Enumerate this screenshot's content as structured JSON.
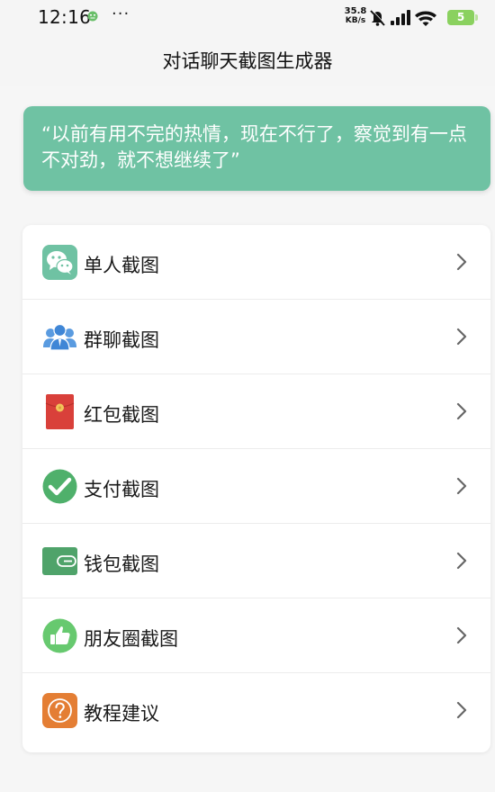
{
  "status_bar": {
    "time": "12:16",
    "dots": "···",
    "speed_value": "35.8",
    "speed_unit": "KB/s",
    "battery": "5",
    "icons": [
      "face-icon",
      "mute-bell-icon",
      "signal-icon",
      "wifi-icon",
      "battery-icon"
    ]
  },
  "header": {
    "title": "对话聊天截图生成器"
  },
  "quote": {
    "text": "“以前有用不完的热情，现在不行了，察觉到有一点不对劲，就不想继续了”",
    "color": "#6fc2a3"
  },
  "menu": {
    "items": [
      {
        "label": "单人截图",
        "icon": "wechat-icon"
      },
      {
        "label": "群聊截图",
        "icon": "group-icon"
      },
      {
        "label": "红包截图",
        "icon": "red-packet-icon"
      },
      {
        "label": "支付截图",
        "icon": "payment-check-icon"
      },
      {
        "label": "钱包截图",
        "icon": "wallet-icon"
      },
      {
        "label": "朋友圈截图",
        "icon": "thumbs-up-icon"
      },
      {
        "label": "教程建议",
        "icon": "question-icon"
      }
    ]
  },
  "colors": {
    "accent_green": "#6fc2a3",
    "wechat_green": "#4fb06b",
    "red": "#d9403a",
    "orange": "#e47e34"
  }
}
